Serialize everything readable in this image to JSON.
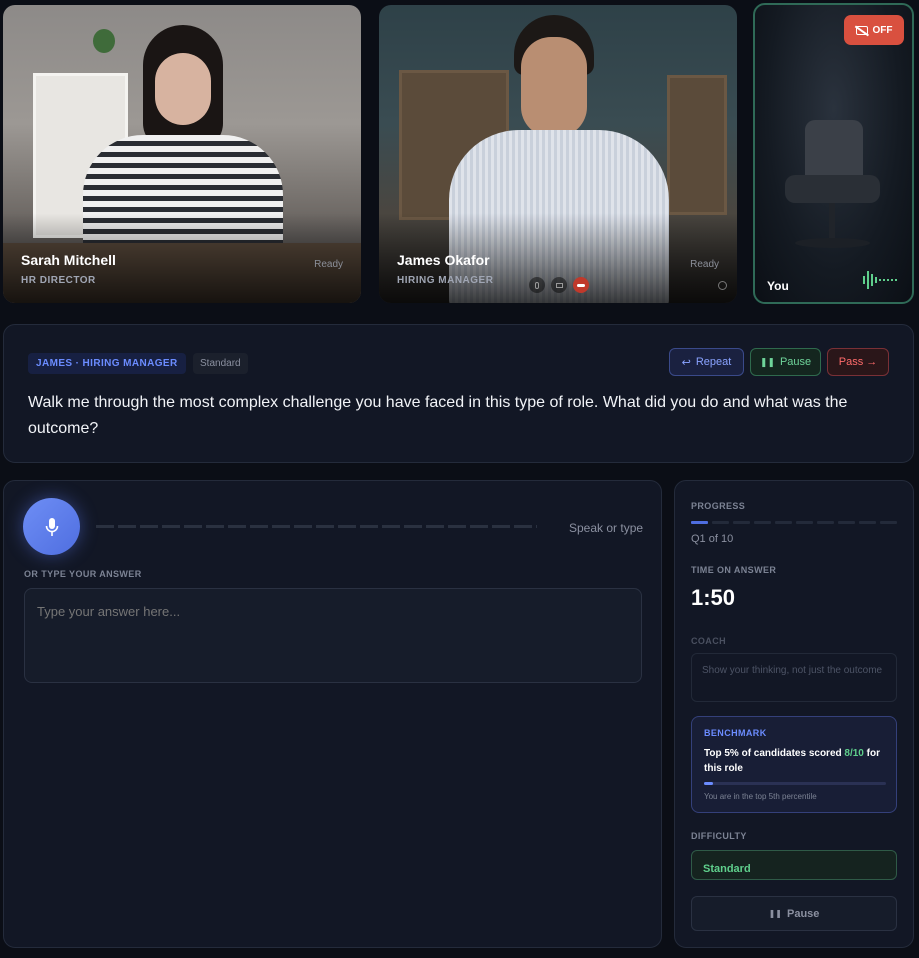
{
  "participants": [
    {
      "name": "Sarah Mitchell",
      "role": "HR DIRECTOR",
      "status": "Ready"
    },
    {
      "name": "James Okafor",
      "role": "HIRING MANAGER",
      "status": "Ready"
    }
  ],
  "self": {
    "label": "You",
    "camera_badge": "OFF"
  },
  "question": {
    "asker_tag": "JAMES · HIRING MANAGER",
    "level_tag": "Standard",
    "text": "Walk me through the most complex challenge you have faced in this type of role. What did you do and what was the outcome?",
    "repeat_label": "Repeat",
    "pause_label": "Pause",
    "pass_label": "Pass →"
  },
  "answer": {
    "speak_hint": "Speak or type",
    "type_label": "OR TYPE YOUR ANSWER",
    "placeholder": "Type your answer here..."
  },
  "sidebar": {
    "progress_label": "PROGRESS",
    "progress_text": "Q1 of 10",
    "progress": {
      "current": 1,
      "total": 10
    },
    "time_label": "TIME ON ANSWER",
    "time_value": "1:50",
    "coach_label": "COACH",
    "coach_text": "Show your thinking, not just the outcome",
    "benchmark_label": "BENCHMARK",
    "benchmark_text_pre": "Top 5% of candidates scored ",
    "benchmark_score": "8/10",
    "benchmark_text_post": " for this role",
    "benchmark_fill": 0.05,
    "benchmark_note": "You are in the top 5th percentile",
    "difficulty_label": "DIFFICULTY",
    "difficulty_value": "Standard",
    "pause_button": "Pause"
  },
  "colors": {
    "accent_blue": "#5b7cf0",
    "green": "#5fcf8c",
    "red": "#e0524a"
  }
}
